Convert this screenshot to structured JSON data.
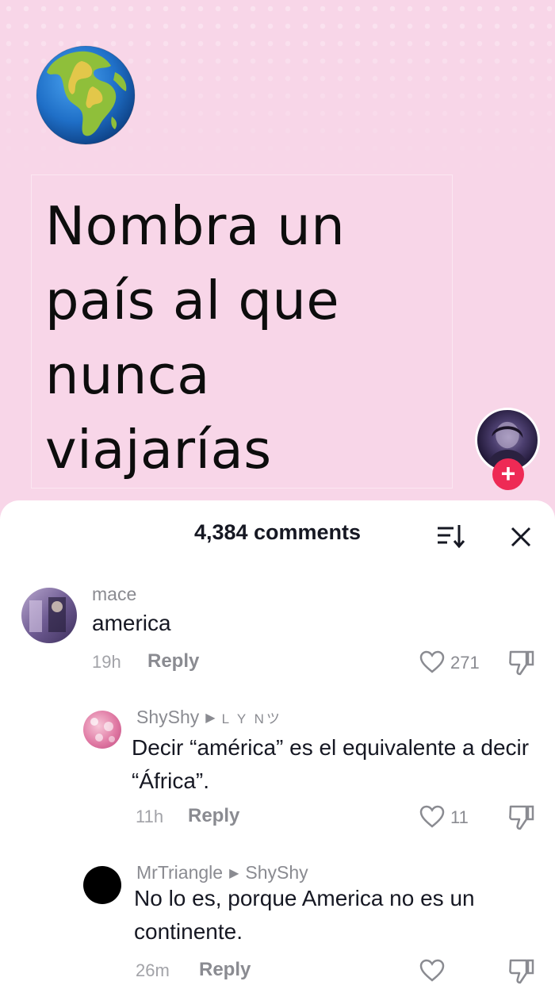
{
  "video": {
    "question": "Nombra un país al que nunca viajarías",
    "icons": {
      "globe": "earth-globe-africa-icon",
      "follow": "plus-icon"
    }
  },
  "comments_header": {
    "count_label": "4,384 comments",
    "sort_icon": "sort-icon",
    "close_icon": "close-icon"
  },
  "comments": [
    {
      "username": "mace",
      "reply_to": "",
      "text": "america",
      "time": "19h",
      "reply_label": "Reply",
      "likes": "271"
    },
    {
      "username": "ShyShy",
      "reply_to": "L Y Nツ",
      "text": "Decir “américa” es el equivalente a decir “África”.",
      "time": "11h",
      "reply_label": "Reply",
      "likes": "11"
    },
    {
      "username": "MrTriangle",
      "reply_to": "ShyShy",
      "text": "No lo es, porque America no es un continente.",
      "time": "26m",
      "reply_label": "Reply",
      "likes": ""
    }
  ],
  "colors": {
    "background": "#f8d6e8",
    "follow_button": "#ee2a55",
    "panel": "#ffffff"
  }
}
